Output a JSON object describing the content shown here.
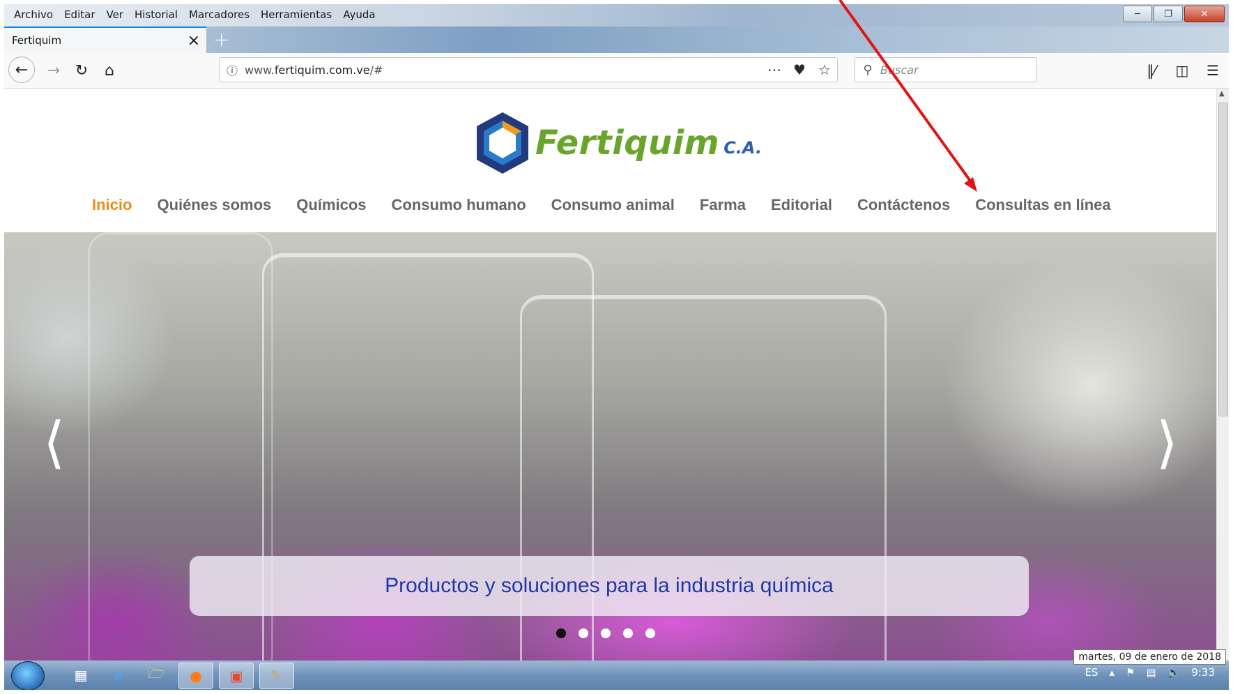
{
  "browser": {
    "menu": [
      "Archivo",
      "Editar",
      "Ver",
      "Historial",
      "Marcadores",
      "Herramientas",
      "Ayuda"
    ],
    "tab_title": "Fertiquim",
    "url_prefix": "www.",
    "url_domain": "fertiquim.com.ve",
    "url_path": "/#",
    "search_placeholder": "Buscar"
  },
  "site": {
    "logo_name": "Fertiquim",
    "logo_suffix": "C.A.",
    "nav": [
      {
        "label": "Inicio",
        "active": true
      },
      {
        "label": "Quiénes somos"
      },
      {
        "label": "Químicos"
      },
      {
        "label": "Consumo humano"
      },
      {
        "label": "Consumo animal"
      },
      {
        "label": "Farma"
      },
      {
        "label": "Editorial"
      },
      {
        "label": "Contáctenos"
      },
      {
        "label": "Consultas en línea"
      }
    ],
    "hero_caption": "Productos y soluciones para la industria química",
    "slides_total": 5,
    "slide_active": 1
  },
  "taskbar": {
    "lang": "ES",
    "time": "9:33",
    "date_tooltip": "martes, 09 de enero de 2018"
  },
  "colors": {
    "nav_active": "#f08a1c",
    "nav_text": "#666666",
    "caption_text": "#2137a6",
    "annotation_arrow": "#e11414"
  }
}
